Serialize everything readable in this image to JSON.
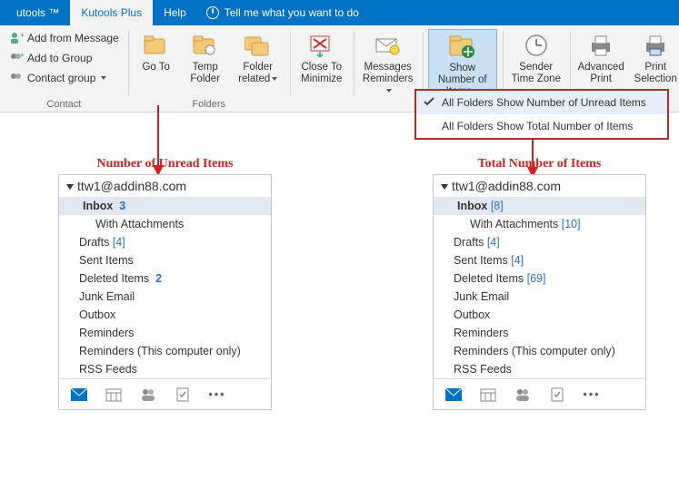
{
  "tabs": {
    "utools": "utools ™",
    "kutools_plus": "Kutools Plus",
    "help": "Help",
    "tell_me": "Tell me what you want to do"
  },
  "ribbon": {
    "contact": {
      "label": "Contact",
      "add_from_message": "Add from Message",
      "add_to_group": "Add to Group",
      "contact_group": "Contact group"
    },
    "folders": {
      "label": "Folders",
      "go_to": "Go To",
      "temp_folder": "Temp Folder",
      "folder_related": "Folder related"
    },
    "close_to_minimize": "Close To Minimize",
    "messages_reminders": "Messages Reminders",
    "show_number_of_items": "Show Number of Items",
    "sender_time_zone": "Sender Time Zone",
    "advanced_print": "Advanced Print",
    "print_selection": "Print Selection"
  },
  "dropdown": {
    "unread": "All Folders Show Number of Unread Items",
    "total": "All Folders Show Total Number of Items"
  },
  "panel_left": {
    "title": "Number of Unread Items",
    "account": "ttw1@addin88.com",
    "inbox": "Inbox",
    "inbox_count": "3",
    "with_attachments": "With Attachments",
    "drafts": "Drafts",
    "drafts_count": "[4]",
    "sent": "Sent Items",
    "deleted": "Deleted Items",
    "deleted_count": "2",
    "junk": "Junk Email",
    "outbox": "Outbox",
    "reminders": "Reminders",
    "reminders_local": "Reminders (This computer only)",
    "rss": "RSS Feeds"
  },
  "panel_right": {
    "title": "Total Number of Items",
    "account": "ttw1@addin88.com",
    "inbox": "Inbox",
    "inbox_count": "[8]",
    "with_attachments": "With Attachments",
    "with_attachments_count": "[10]",
    "drafts": "Drafts",
    "drafts_count": "[4]",
    "sent": "Sent Items",
    "sent_count": "[4]",
    "deleted": "Deleted Items",
    "deleted_count": "[69]",
    "junk": "Junk Email",
    "outbox": "Outbox",
    "reminders": "Reminders",
    "reminders_local": "Reminders (This computer only)",
    "rss": "RSS Feeds"
  }
}
